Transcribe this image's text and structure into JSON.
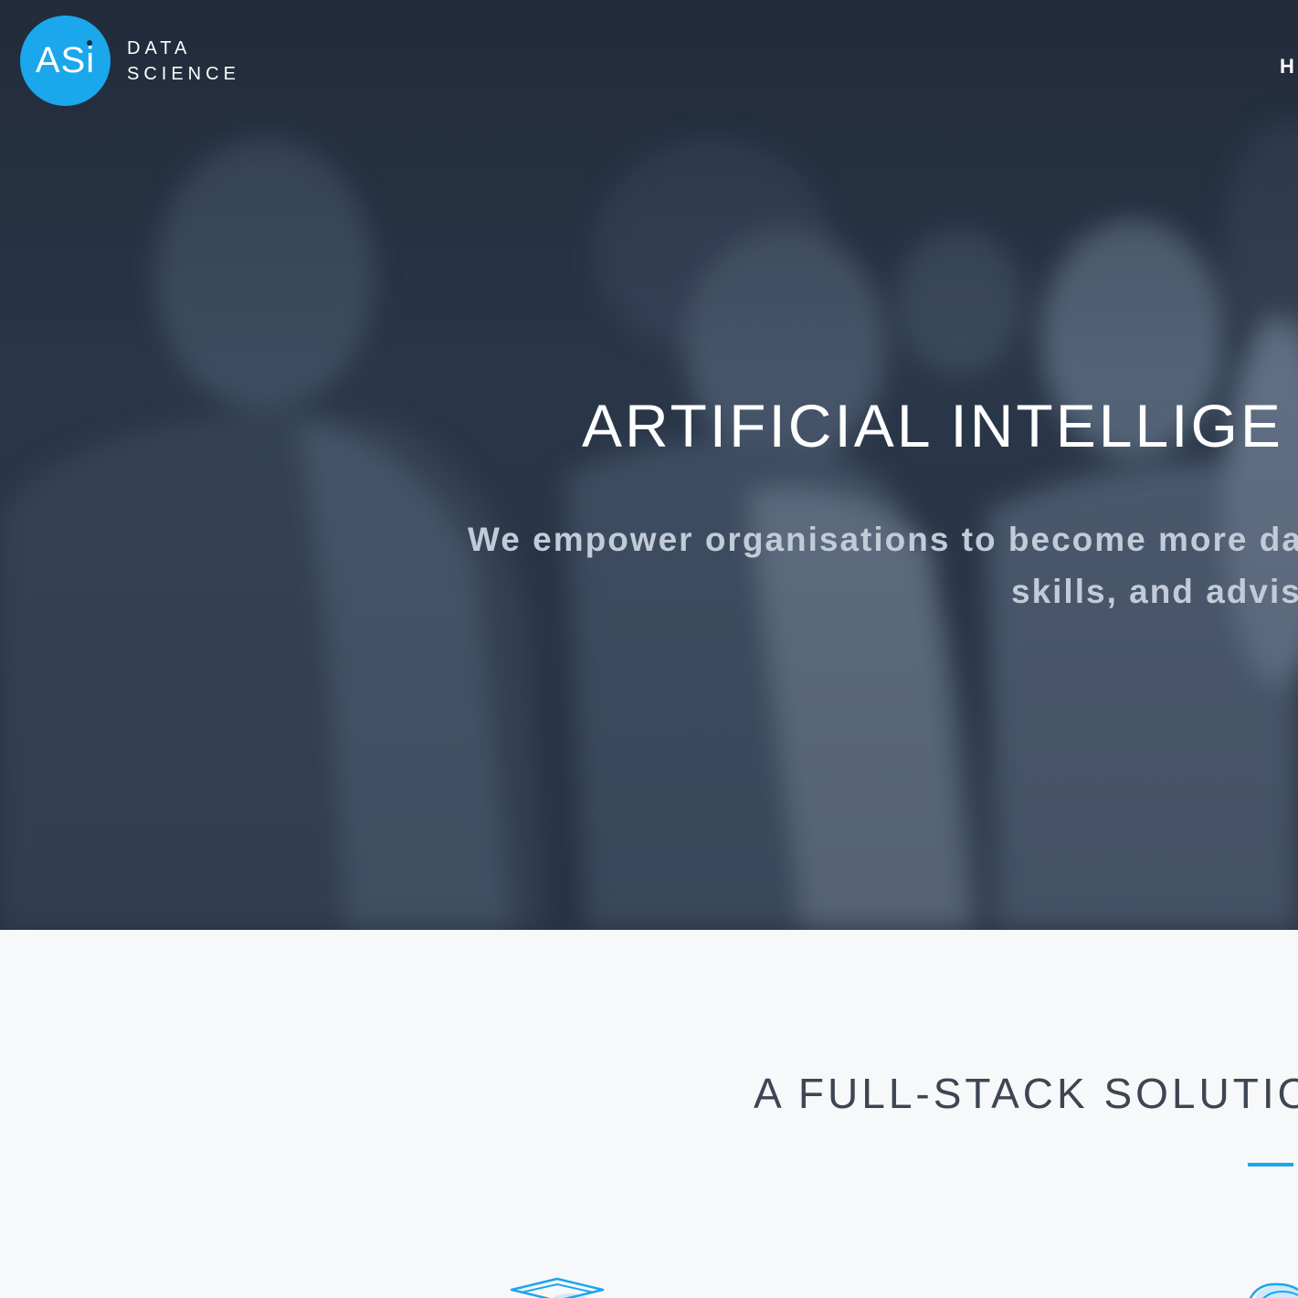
{
  "header": {
    "logo_mark": "ASi",
    "logo_line1": "DATA",
    "logo_line2": "SCIENCE",
    "nav_item": "H"
  },
  "hero": {
    "title": "ARTIFICIAL INTELLIGE",
    "subtitle_line1": "We empower organisations to become more da",
    "subtitle_line2": "skills, and advis"
  },
  "section": {
    "title": "A FULL-STACK SOLUTIO",
    "icons": [
      "graduation-cap-icon",
      "cloud-icon"
    ]
  },
  "colors": {
    "accent": "#1aa7ec",
    "hero_bg": "#2a374a",
    "section_bg": "#f7f8fa",
    "heading_text": "#3e4553"
  }
}
